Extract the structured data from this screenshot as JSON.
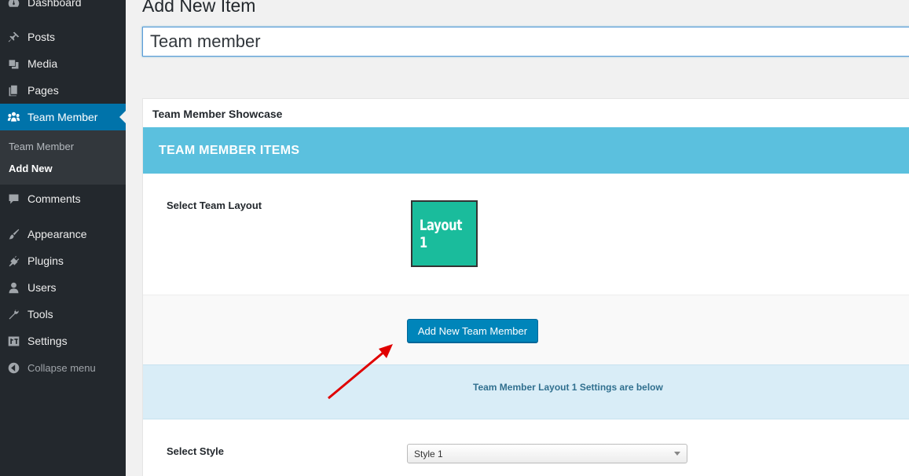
{
  "sidebar": {
    "items": [
      {
        "label": "Dashboard",
        "icon": "dashboard-icon"
      },
      {
        "label": "Posts",
        "icon": "pin-icon"
      },
      {
        "label": "Media",
        "icon": "media-icon"
      },
      {
        "label": "Pages",
        "icon": "pages-icon"
      },
      {
        "label": "Team Member",
        "icon": "team-icon"
      },
      {
        "label": "Comments",
        "icon": "comments-icon"
      },
      {
        "label": "Appearance",
        "icon": "paintbrush-icon"
      },
      {
        "label": "Plugins",
        "icon": "plugin-icon"
      },
      {
        "label": "Users",
        "icon": "users-icon"
      },
      {
        "label": "Tools",
        "icon": "wrench-icon"
      },
      {
        "label": "Settings",
        "icon": "settings-icon"
      },
      {
        "label": "Collapse menu",
        "icon": "collapse-icon"
      }
    ],
    "submenu": [
      {
        "label": "Team Member"
      },
      {
        "label": "Add New"
      }
    ]
  },
  "page": {
    "title": "Add New Item",
    "title_value": "Team member"
  },
  "metabox": {
    "title": "Team Member Showcase",
    "header": "TEAM MEMBER ITEMS",
    "layout_label": "Select Team Layout",
    "layout_thumb": "Layout 1",
    "add_button": "Add New Team Member",
    "settings_note": "Team Member Layout 1 Settings are below",
    "style_label": "Select Style",
    "style_value": "Style 1"
  },
  "colors": {
    "sidebar": "#23282d",
    "active": "#0073aa",
    "header": "#5bc0de",
    "layout_thumb": "#1abc9c",
    "info": "#d9edf7",
    "arrow": "#e00000"
  }
}
